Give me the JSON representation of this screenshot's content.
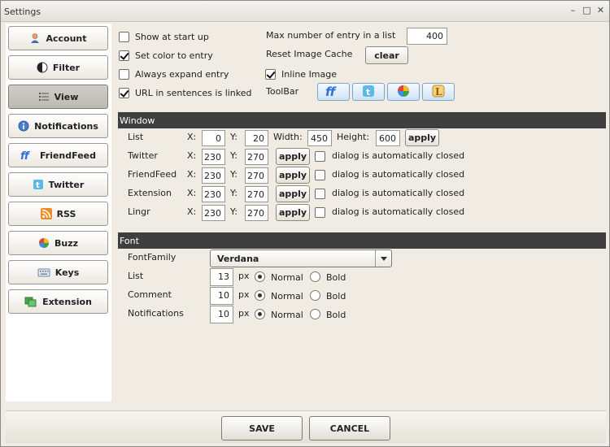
{
  "window": {
    "title": "Settings",
    "min": "–",
    "max": "□",
    "close": "✕"
  },
  "sidebar": {
    "items": [
      {
        "label": "Account",
        "icon": "user-icon"
      },
      {
        "label": "Filter",
        "icon": "filter-icon"
      },
      {
        "label": "View",
        "icon": "list-icon",
        "active": true
      },
      {
        "label": "Notifications",
        "icon": "info-icon"
      },
      {
        "label": "FriendFeed",
        "icon": "friendfeed-icon"
      },
      {
        "label": "Twitter",
        "icon": "twitter-icon"
      },
      {
        "label": "RSS",
        "icon": "rss-icon"
      },
      {
        "label": "Buzz",
        "icon": "buzz-icon"
      },
      {
        "label": "Keys",
        "icon": "keyboard-icon"
      },
      {
        "label": "Extension",
        "icon": "extension-icon"
      }
    ]
  },
  "general": {
    "show_at_startup": {
      "label": "Show at start up",
      "checked": false
    },
    "set_color": {
      "label": "Set color to entry",
      "checked": true
    },
    "always_expand": {
      "label": "Always expand entry",
      "checked": false
    },
    "url_linked": {
      "label": "URL in sentences is linked",
      "checked": true
    },
    "max_entry_label": "Max number of entry in a list",
    "max_entry_value": "400",
    "reset_cache_label": "Reset Image Cache",
    "clear_label": "clear",
    "inline_image": {
      "label": "Inline Image",
      "checked": true
    },
    "toolbar_label": "ToolBar",
    "toolbar_icons": [
      "friendfeed-icon",
      "twitter-icon",
      "buzz-icon",
      "lingr-icon"
    ]
  },
  "window_section": {
    "title": "Window",
    "x_label": "X:",
    "y_label": "Y:",
    "width_label": "Width:",
    "height_label": "Height:",
    "apply_label": "apply",
    "auto_close_label": "dialog is automatically closed",
    "list": {
      "label": "List",
      "x": "0",
      "y": "20",
      "width": "450",
      "height": "600"
    },
    "rows": [
      {
        "label": "Twitter",
        "x": "230",
        "y": "270"
      },
      {
        "label": "FriendFeed",
        "x": "230",
        "y": "270"
      },
      {
        "label": "Extension",
        "x": "230",
        "y": "270"
      },
      {
        "label": "Lingr",
        "x": "230",
        "y": "270"
      }
    ]
  },
  "font_section": {
    "title": "Font",
    "family_label": "FontFamily",
    "family_value": "Verdana",
    "unit": "px",
    "normal_label": "Normal",
    "bold_label": "Bold",
    "rows": [
      {
        "label": "List",
        "size": "13",
        "weight": "Normal"
      },
      {
        "label": "Comment",
        "size": "10",
        "weight": "Normal"
      },
      {
        "label": "Notifications",
        "size": "10",
        "weight": "Normal"
      }
    ]
  },
  "footer": {
    "save_label": "SAVE",
    "cancel_label": "CANCEL"
  }
}
